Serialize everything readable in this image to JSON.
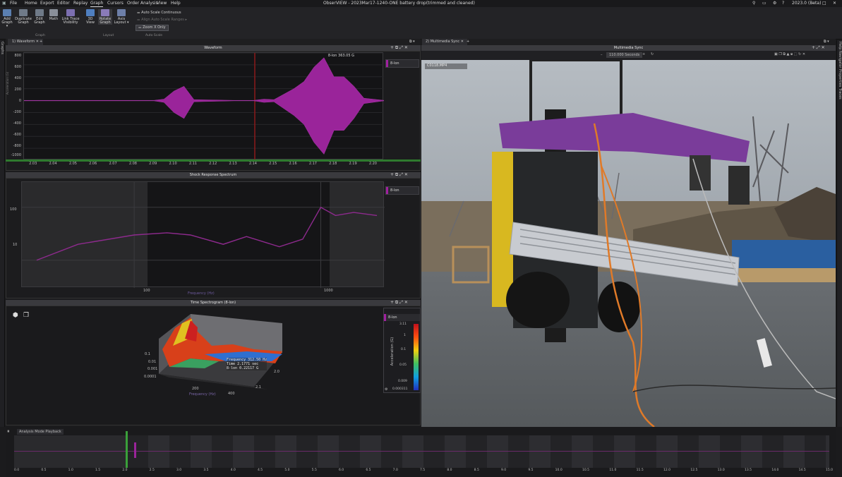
{
  "titlebar": {
    "title": "ObserVIEW - 2023Mar17-1240-ONE battery drop(trimmed and cleaned)",
    "version": "2023.0 (Beta)"
  },
  "menu": [
    "File",
    "Home",
    "Export",
    "Editor",
    "Replay",
    "Graph",
    "Cursors",
    "Order Analysis",
    "View",
    "Help"
  ],
  "ribbon": {
    "buttons": [
      {
        "label": "Add\nGraph ▾"
      },
      {
        "label": "Duplicate\nGraph"
      },
      {
        "label": "Edit\nGraph"
      },
      {
        "label": "Math"
      },
      {
        "label": "Link Trace\nVisibility"
      },
      {
        "label": "3D\nView"
      },
      {
        "label": "Rotate\nGraph"
      },
      {
        "label": "Axis\nLayout ▾"
      }
    ],
    "groups": [
      "Graph",
      "Layout",
      "Auto Scale"
    ],
    "auto_scale_continuous": "Auto Scale Continuous",
    "align_auto_scale": "Align Auto Scale Ranges",
    "zoom_x_only": "Zoom X Only"
  },
  "left_strip": "Graphs",
  "right_strip": "Help  Navigator  Properties  Traces",
  "left_tab": "1) Waveform",
  "right_tab": "2) Multimedia Sync",
  "waveform": {
    "title": "Waveform",
    "cursor_readout": "8-lon   363.05  G",
    "legend": "8-lon",
    "ylabel": "Acceleration (G)",
    "yticks": [
      "800",
      "600",
      "400",
      "200",
      "0",
      "-200",
      "-400",
      "-600",
      "-800",
      "-1000"
    ],
    "xticks": [
      "2.03",
      "2.04",
      "2.05",
      "2.06",
      "2.07",
      "2.08",
      "2.09",
      "2.10",
      "2.11",
      "2.12",
      "2.13",
      "2.14",
      "2.15",
      "2.16",
      "2.17",
      "2.18",
      "2.19",
      "2.20"
    ]
  },
  "chart_data": [
    {
      "type": "line",
      "title": "Waveform",
      "ylabel": "Acceleration (G)",
      "xlabel": "",
      "ylim": [
        -1000,
        800
      ],
      "xlim": [
        2.025,
        2.205
      ],
      "series": [
        {
          "name": "8-lon",
          "x": [
            2.025,
            2.09,
            2.095,
            2.1,
            2.105,
            2.11,
            2.13,
            2.14,
            2.145,
            2.15,
            2.16,
            2.165,
            2.17,
            2.175,
            2.18,
            2.185,
            2.19,
            2.195,
            2.205
          ],
          "y": [
            0,
            0,
            -30,
            200,
            -300,
            20,
            0,
            0,
            30,
            -20,
            250,
            -400,
            700,
            -900,
            500,
            -500,
            300,
            -50,
            0
          ]
        }
      ]
    },
    {
      "type": "line",
      "title": "Shock Response Spectrum",
      "ylabel": "Acceleration (G)",
      "xlabel": "Frequency (Hz)",
      "xscale": "log",
      "yscale": "log",
      "series": [
        {
          "name": "8-lon",
          "x": [
            30,
            50,
            100,
            150,
            200,
            300,
            400,
            600,
            800,
            1000,
            1200,
            1500,
            2000
          ],
          "y": [
            10,
            20,
            30,
            33,
            30,
            20,
            28,
            18,
            25,
            100,
            70,
            80,
            70
          ]
        }
      ]
    }
  ],
  "srs": {
    "title": "Shock Response Spectrum",
    "legend": "8-lon",
    "ylabel": "Acceleration (G)",
    "xlabel": "Frequency (Hz)",
    "yticks": [
      "100",
      "10"
    ],
    "xticks": [
      "100",
      "1000"
    ]
  },
  "spectrogram": {
    "title": "Time Spectrogram (8-lon)",
    "legend": "8-lon",
    "colorbar_label": "Acceleration (G)",
    "colorbar_ticks": [
      "3.11",
      "1",
      "0.1",
      "0.05",
      "0.009",
      "0.000311"
    ],
    "z_ticks": [
      "0.1",
      "0.01",
      "0.001",
      "0.0001"
    ],
    "x_ticks": [
      "200",
      "400"
    ],
    "x_label": "Frequency (Hz)",
    "t_ticks": [
      "2.0",
      "2.1"
    ],
    "readout": [
      [
        "Frequency",
        "312.50",
        "Hz"
      ],
      [
        "Time",
        "2.1771",
        "sec"
      ],
      [
        "8-lon",
        "0.22117",
        "G"
      ]
    ]
  },
  "multimedia": {
    "title": "Multimedia Sync",
    "time": "110.000  Seconds",
    "file": "C0118.MP4"
  },
  "playback": {
    "label": "Analysis Mode Playback",
    "ticks": [
      "0.0",
      "0.5",
      "1.0",
      "1.5",
      "2.0",
      "2.5",
      "3.0",
      "3.5",
      "4.0",
      "4.5",
      "5.0",
      "5.5",
      "6.0",
      "6.5",
      "7.0",
      "7.5",
      "8.0",
      "8.5",
      "9.0",
      "9.5",
      "10.0",
      "10.5",
      "11.0",
      "11.5",
      "12.0",
      "12.5",
      "13.0",
      "13.5",
      "14.0",
      "14.5",
      "15.0"
    ]
  }
}
